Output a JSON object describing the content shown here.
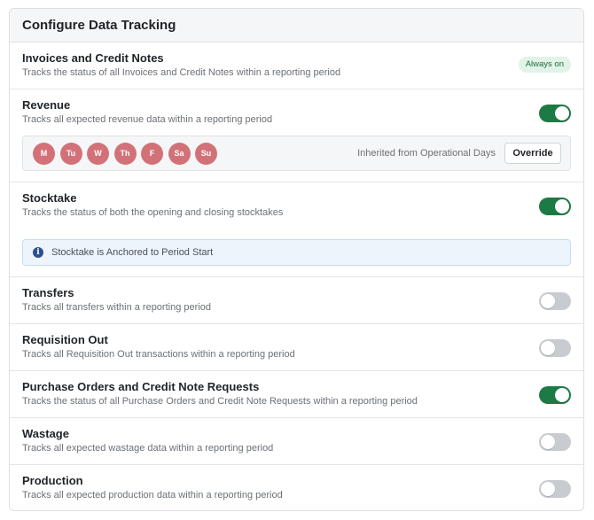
{
  "header": {
    "title": "Configure Data Tracking"
  },
  "colors": {
    "toggle_on": "#1e7a44",
    "toggle_off": "#c8cbcf",
    "day_pill": "#d27278",
    "badge_bg": "#e2f3e8"
  },
  "rows": [
    {
      "title": "Invoices and Credit Notes",
      "desc": "Tracks the status of all Invoices and Credit Notes within a reporting period",
      "badge": "Always on"
    },
    {
      "title": "Revenue",
      "desc": "Tracks all expected revenue data within a reporting period",
      "enabled": true,
      "days": [
        "M",
        "Tu",
        "W",
        "Th",
        "F",
        "Sa",
        "Su"
      ],
      "inherited_text": "Inherited from Operational Days",
      "override_label": "Override"
    },
    {
      "title": "Stocktake",
      "desc": "Tracks the status of both the opening and closing stocktakes",
      "enabled": true,
      "info_icon": "info-circle-icon",
      "info_text": "Stocktake is Anchored to Period Start"
    },
    {
      "title": "Transfers",
      "desc": "Tracks all transfers within a reporting period",
      "enabled": false
    },
    {
      "title": "Requisition Out",
      "desc": "Tracks all Requisition Out transactions within a reporting period",
      "enabled": false
    },
    {
      "title": "Purchase Orders and Credit Note Requests",
      "desc": "Tracks the status of all Purchase Orders and Credit Note Requests within a reporting period",
      "enabled": true
    },
    {
      "title": "Wastage",
      "desc": "Tracks all expected wastage data within a reporting period",
      "enabled": false
    },
    {
      "title": "Production",
      "desc": "Tracks all expected production data within a reporting period",
      "enabled": false
    }
  ]
}
